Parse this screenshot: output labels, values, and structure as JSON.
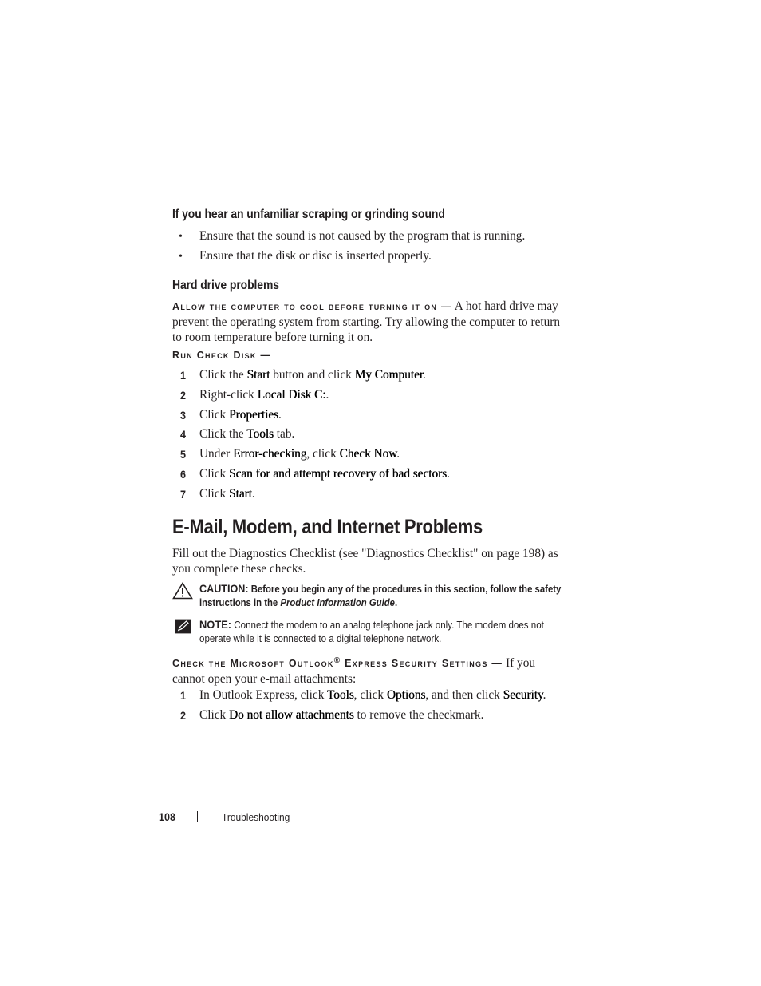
{
  "sections": {
    "grinding": {
      "heading": "If you hear an unfamiliar scraping or grinding sound",
      "bullets": [
        "Ensure that the sound is not caused by the program that is running.",
        "Ensure that the disk or disc is inserted properly."
      ]
    },
    "hard_drive": {
      "heading": "Hard drive problems",
      "cool": {
        "lead": "Allow the computer to cool before turning it on —",
        "text": "A hot hard drive may prevent the operating system from starting. Try allowing the computer to return to room temperature before turning it on."
      },
      "check_disk": {
        "lead": "Run Check Disk —",
        "steps": [
          {
            "num": "1",
            "parts": [
              [
                "Click the ",
                false
              ],
              [
                "Start",
                true
              ],
              [
                " button and click ",
                false
              ],
              [
                "My Computer",
                true
              ],
              [
                ".",
                false
              ]
            ]
          },
          {
            "num": "2",
            "parts": [
              [
                "Right-click ",
                false
              ],
              [
                "Local Disk C:",
                true
              ],
              [
                ".",
                false
              ]
            ]
          },
          {
            "num": "3",
            "parts": [
              [
                "Click ",
                false
              ],
              [
                "Properties",
                true
              ],
              [
                ".",
                false
              ]
            ]
          },
          {
            "num": "4",
            "parts": [
              [
                "Click the ",
                false
              ],
              [
                "Tools",
                true
              ],
              [
                " tab.",
                false
              ]
            ]
          },
          {
            "num": "5",
            "parts": [
              [
                "Under ",
                false
              ],
              [
                "Error-checking",
                true
              ],
              [
                ", click ",
                false
              ],
              [
                "Check Now",
                true
              ],
              [
                ".",
                false
              ]
            ]
          },
          {
            "num": "6",
            "parts": [
              [
                "Click ",
                false
              ],
              [
                "Scan for and attempt recovery of bad sectors",
                true
              ],
              [
                ".",
                false
              ]
            ]
          },
          {
            "num": "7",
            "parts": [
              [
                "Click ",
                false
              ],
              [
                "Start",
                true
              ],
              [
                ".",
                false
              ]
            ]
          }
        ]
      }
    },
    "email": {
      "heading": "E-Mail, Modem, and Internet Problems",
      "intro": "Fill out the Diagnostics Checklist (see \"Diagnostics Checklist\" on page 198) as you complete these checks.",
      "caution": {
        "icon": "warning-triangle-icon",
        "lead": "CAUTION:",
        "text_before": "Before you begin any of the procedures in this section, follow the safety instructions in the ",
        "italic": "Product Information Guide",
        "text_after": "."
      },
      "note": {
        "icon": "pencil-note-icon",
        "lead": "NOTE:",
        "text": "Connect the modem to an analog telephone jack only. The modem does not operate while it is connected to a digital telephone network."
      },
      "outlook": {
        "lead_part1": "Check the Microsoft Outlook",
        "lead_reg": "®",
        "lead_part2": "Express Security Settings —",
        "text": "If you cannot open your e-mail attachments:",
        "steps": [
          {
            "num": "1",
            "parts": [
              [
                "In Outlook Express, click ",
                false
              ],
              [
                "Tools",
                true
              ],
              [
                ", click ",
                false
              ],
              [
                "Options",
                true
              ],
              [
                ", and then click ",
                false
              ],
              [
                "Security",
                true
              ],
              [
                ".",
                false
              ]
            ]
          },
          {
            "num": "2",
            "parts": [
              [
                "Click ",
                false
              ],
              [
                "Do not allow attachments",
                true
              ],
              [
                " to remove the checkmark.",
                false
              ]
            ]
          }
        ]
      }
    }
  },
  "footer": {
    "page_number": "108",
    "separator": "|",
    "section": "Troubleshooting"
  }
}
